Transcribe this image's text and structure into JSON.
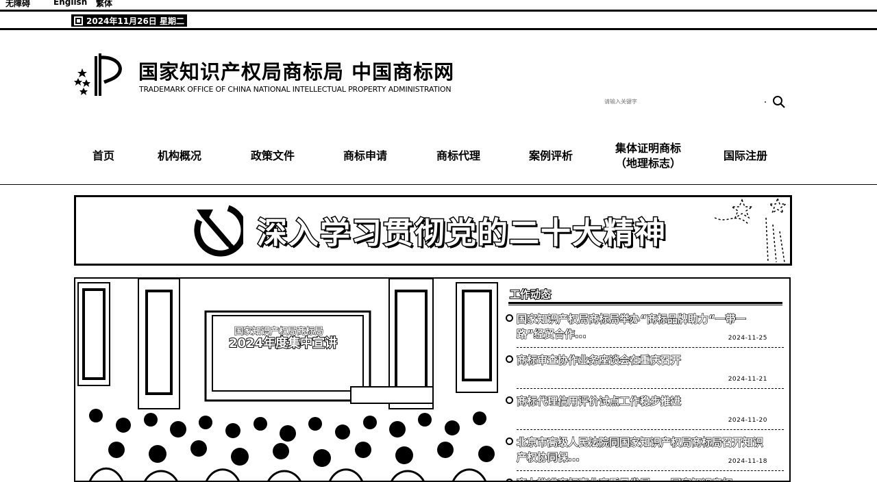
{
  "top_util": {
    "fragments": [
      "无障碍",
      "English",
      "繁体"
    ]
  },
  "date_bar": {
    "date": "2024年11月26日 星期二",
    "icon": "calendar-icon"
  },
  "header": {
    "title": "国家知识产权局商标局 中国商标网",
    "subtitle": "TRADEMARK OFFICE OF CHINA NATIONAL INTELLECTUAL PROPERTY ADMINISTRATION",
    "logo_icon": "cnipa-logo-icon"
  },
  "search": {
    "placeholder": "请输入关键字",
    "icon": "search-icon"
  },
  "nav": {
    "items": [
      {
        "label": "首页"
      },
      {
        "label": "机构概况"
      },
      {
        "label": "政策文件"
      },
      {
        "label": "商标申请"
      },
      {
        "label": "商标代理"
      },
      {
        "label": "案例评析"
      },
      {
        "label": "集体证明商标\n（地理标志）"
      },
      {
        "label": "国际注册"
      }
    ]
  },
  "banner": {
    "text": "深入学习贯彻党的二十大精神",
    "icon": "party-emblem-icon"
  },
  "photo": {
    "screen_title": "国家知识产权局商标局",
    "screen_main": "2024年度集中宣讲"
  },
  "news": {
    "header": "工作动态",
    "items": [
      {
        "title": "国家知识产权局商标局举办“商标品牌助力“一带一路”经贸合作...",
        "date": "2024-11-25"
      },
      {
        "title": "商标审查协作业务座谈会在重庆召开",
        "date": "2024-11-21"
      },
      {
        "title": "商标代理信用评价试点工作稳步推进",
        "date": "2024-11-20"
      },
      {
        "title": "北京市高级人民法院同国家知识产权局商标局召开知识产权协同保...",
        "date": "2024-11-18"
      },
      {
        "title": "齐力推进商标事业高质量发展——国家知识产权",
        "date": ""
      }
    ]
  }
}
